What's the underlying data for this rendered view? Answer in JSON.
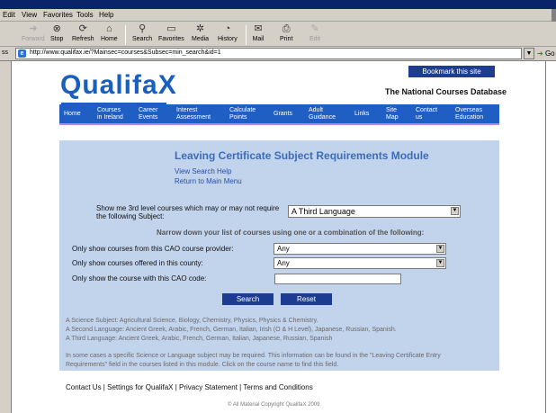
{
  "browser": {
    "menu": [
      "Edit",
      "View",
      "Favorites",
      "Tools",
      "Help"
    ],
    "toolbar": {
      "forward": "Forward",
      "stop": "Stop",
      "refresh": "Refresh",
      "home": "Home",
      "search": "Search",
      "favorites": "Favorites",
      "media": "Media",
      "history": "History",
      "mail": "Mail",
      "print": "Print",
      "edit": "Edit"
    },
    "address_label": "ss",
    "url": "http://www.qualifax.ie/?Mainsec=courses&Subsec=min_search&id=1",
    "go": "Go",
    "links": "L"
  },
  "site": {
    "logo": "QualifaX",
    "bookmark": "Bookmark this site",
    "tagline": "The National Courses Database",
    "nav": [
      {
        "line1": "Home",
        "line2": ""
      },
      {
        "line1": "Courses",
        "line2": "in Ireland"
      },
      {
        "line1": "Career",
        "line2": "Events"
      },
      {
        "line1": "Interest",
        "line2": "Assessment"
      },
      {
        "line1": "Calculate",
        "line2": "Points"
      },
      {
        "line1": "Grants",
        "line2": ""
      },
      {
        "line1": "Adult",
        "line2": "Guidance"
      },
      {
        "line1": "Links",
        "line2": ""
      },
      {
        "line1": "Site",
        "line2": "Map"
      },
      {
        "line1": "Contact",
        "line2": "us"
      },
      {
        "line1": "Overseas",
        "line2": "Education"
      }
    ]
  },
  "module": {
    "title": "Leaving Certificate Subject Requirements Module",
    "view_help": "View Search Help",
    "return_main": "Return to Main Menu",
    "show_me_line1": "Show me 3rd level courses which may or may not require",
    "show_me_line2": "the following Subject:",
    "subject_value": "A Third Language",
    "narrow": "Narrow down your list of courses using one or a combination of the following:",
    "provider_label": "Only show courses from this CAO course provider:",
    "provider_value": "Any",
    "county_label": "Only show courses offered in this county:",
    "county_value": "Any",
    "code_label": "Only show the course with this CAO code:",
    "code_value": "",
    "search_btn": "Search",
    "reset_btn": "Reset",
    "notes": [
      "A Science Subject: Agricultural Science, Biology, Chemistry, Physics, Physics & Chemistry.",
      "A Second Language: Ancient Greek, Arabic, French, German, Italian, Irish (O & H Level), Japanese, Russian, Spanish.",
      "A Third Language: Ancient Greek, Arabic, French, German, Italian, Japanese, Russian, Spanish"
    ],
    "info_line1": "In some cases a specific Science or Language subject may be required. This information can be found in the \"Leaving Certificate Entry",
    "info_line2": "Requirements\" field in the courses listed in this module. Click on the course name to find this field."
  },
  "footer": {
    "contact": "Contact Us",
    "settings": "Settings for QualifaX",
    "privacy": "Privacy Statement",
    "terms": "Terms and Conditions",
    "sep": " | ",
    "copyright": "© All Material Copyright QualifaX 2009"
  }
}
